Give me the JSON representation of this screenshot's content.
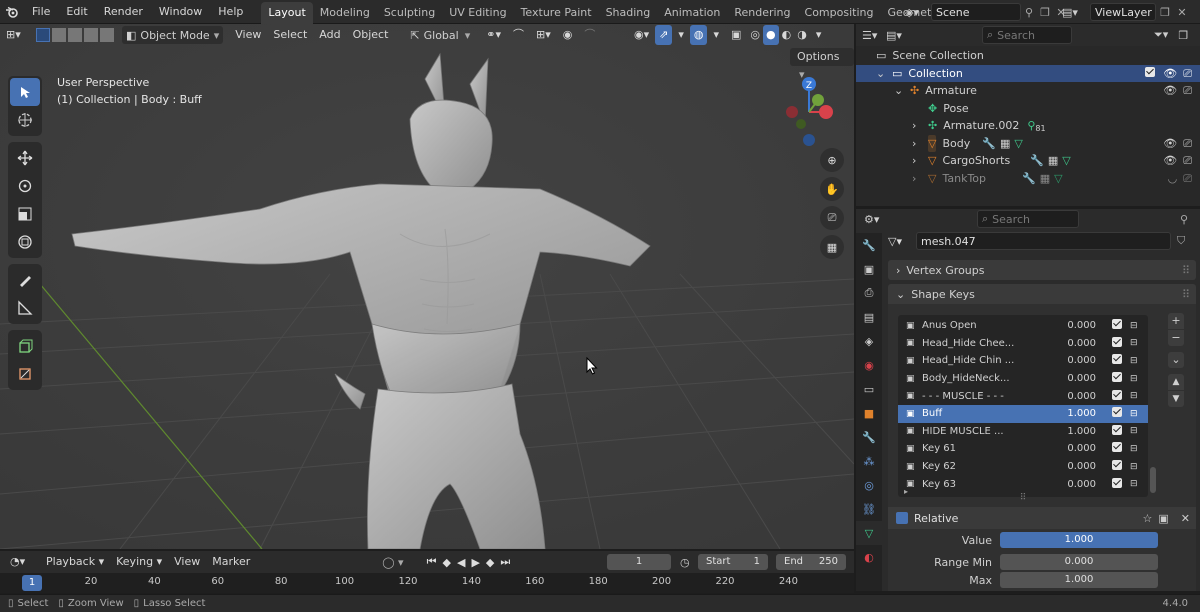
{
  "topbar": {
    "menus": [
      "File",
      "Edit",
      "Render",
      "Window",
      "Help"
    ],
    "workspaces": [
      "Layout",
      "Modeling",
      "Sculpting",
      "UV Editing",
      "Texture Paint",
      "Shading",
      "Animation",
      "Rendering",
      "Compositing",
      "Geometry Nodes"
    ],
    "active_workspace": "Layout",
    "scene": "Scene",
    "view_layer": "ViewLayer"
  },
  "viewport": {
    "mode": "Object Mode",
    "menus": [
      "View",
      "Select",
      "Add",
      "Object"
    ],
    "transform_orientation": "Global",
    "options_label": "Options",
    "overlay_title": "User Perspective",
    "overlay_subtitle": "(1) Collection | Body : Buff",
    "gizmo_z": "Z"
  },
  "outliner": {
    "search_placeholder": "Search",
    "items": [
      {
        "label": "Scene Collection"
      },
      {
        "label": "Collection"
      },
      {
        "label": "Armature"
      },
      {
        "label": "Pose"
      },
      {
        "label": "Armature.002",
        "badge": "81"
      },
      {
        "label": "Body"
      },
      {
        "label": "CargoShorts"
      },
      {
        "label": "TankTop"
      }
    ]
  },
  "properties": {
    "search_placeholder": "Search",
    "mesh_name": "mesh.047",
    "panel_vertex_groups": "Vertex Groups",
    "panel_shape_keys": "Shape Keys",
    "shape_keys": [
      {
        "name": "Anus Open",
        "value": "0.000"
      },
      {
        "name": "Head_Hide Chee...",
        "value": "0.000"
      },
      {
        "name": "Head_Hide Chin ...",
        "value": "0.000"
      },
      {
        "name": "Body_HideNeck...",
        "value": "0.000"
      },
      {
        "name": "- - - MUSCLE - - -",
        "value": "0.000"
      },
      {
        "name": "Buff",
        "value": "1.000"
      },
      {
        "name": "HIDE MUSCLE ...",
        "value": "1.000"
      },
      {
        "name": "Key 61",
        "value": "0.000"
      },
      {
        "name": "Key 62",
        "value": "0.000"
      },
      {
        "name": "Key 63",
        "value": "0.000"
      }
    ],
    "selected_key": "Buff",
    "relative_label": "Relative",
    "value_label": "Value",
    "value": "1.000",
    "range_min_label": "Range Min",
    "range_min": "0.000",
    "max_label": "Max",
    "max": "1.000"
  },
  "timeline": {
    "menus": [
      "Playback",
      "Keying",
      "View",
      "Marker"
    ],
    "current_frame": "1",
    "start_label": "Start",
    "start": "1",
    "end_label": "End",
    "end": "250",
    "ruler": [
      "20",
      "40",
      "60",
      "80",
      "100",
      "120",
      "140",
      "160",
      "180",
      "200",
      "220",
      "240"
    ],
    "playhead": "1"
  },
  "statusbar": {
    "select": "Select",
    "zoom": "Zoom View",
    "lasso": "Lasso Select",
    "version": "4.4.0"
  },
  "colors": {
    "accent": "#4772b3",
    "axis_x": "#d9424b",
    "axis_y": "#71a13b",
    "axis_z": "#3a79d6",
    "orange_object": "#e0822c",
    "green_data": "#3fc98b"
  }
}
